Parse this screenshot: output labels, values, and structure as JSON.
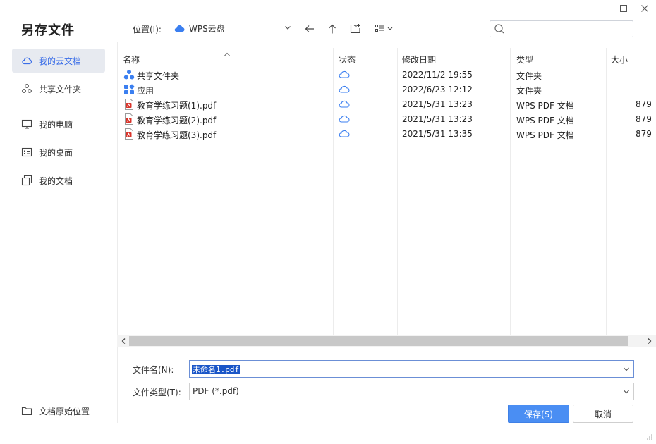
{
  "dialog": {
    "title": "另存文件"
  },
  "sidebar": {
    "items": [
      {
        "label": "我的云文档",
        "icon": "cloud-icon",
        "active": true
      },
      {
        "label": "共享文件夹",
        "icon": "share-folder-icon"
      },
      {
        "label": "我的电脑",
        "icon": "monitor-icon"
      },
      {
        "label": "我的桌面",
        "icon": "desktop-icon"
      },
      {
        "label": "我的文档",
        "icon": "documents-icon"
      }
    ],
    "bottom_label": "文档原始位置"
  },
  "location": {
    "label": "位置(I):",
    "value": "WPS云盘"
  },
  "search": {
    "placeholder": ""
  },
  "columns": {
    "name": "名称",
    "status": "状态",
    "modified": "修改日期",
    "type": "类型",
    "size": "大小"
  },
  "files": [
    {
      "name": "共享文件夹",
      "icon": "shared-folder-icon",
      "modified": "2022/11/2 19:55",
      "type": "文件夹",
      "size": ""
    },
    {
      "name": "应用",
      "icon": "apps-icon",
      "modified": "2022/6/23 12:12",
      "type": "文件夹",
      "size": ""
    },
    {
      "name": "教育学练习题(1).pdf",
      "icon": "pdf-icon",
      "modified": "2021/5/31 13:23",
      "type": "WPS PDF 文档",
      "size": "879"
    },
    {
      "name": "教育学练习题(2).pdf",
      "icon": "pdf-icon",
      "modified": "2021/5/31 13:23",
      "type": "WPS PDF 文档",
      "size": "879"
    },
    {
      "name": "教育学练习题(3).pdf",
      "icon": "pdf-icon",
      "modified": "2021/5/31 13:35",
      "type": "WPS PDF 文档",
      "size": "879"
    }
  ],
  "form": {
    "filename_label": "文件名(N):",
    "filename_value": "未命名1.pdf",
    "filetype_label": "文件类型(T):",
    "filetype_value": "PDF (*.pdf)"
  },
  "buttons": {
    "save": "保存(S)",
    "cancel": "取消"
  },
  "colors": {
    "accent": "#4a8ef3",
    "cloud_blue": "#3b7ff0",
    "pdf_red": "#d9342b",
    "selection": "#1a56c8"
  }
}
